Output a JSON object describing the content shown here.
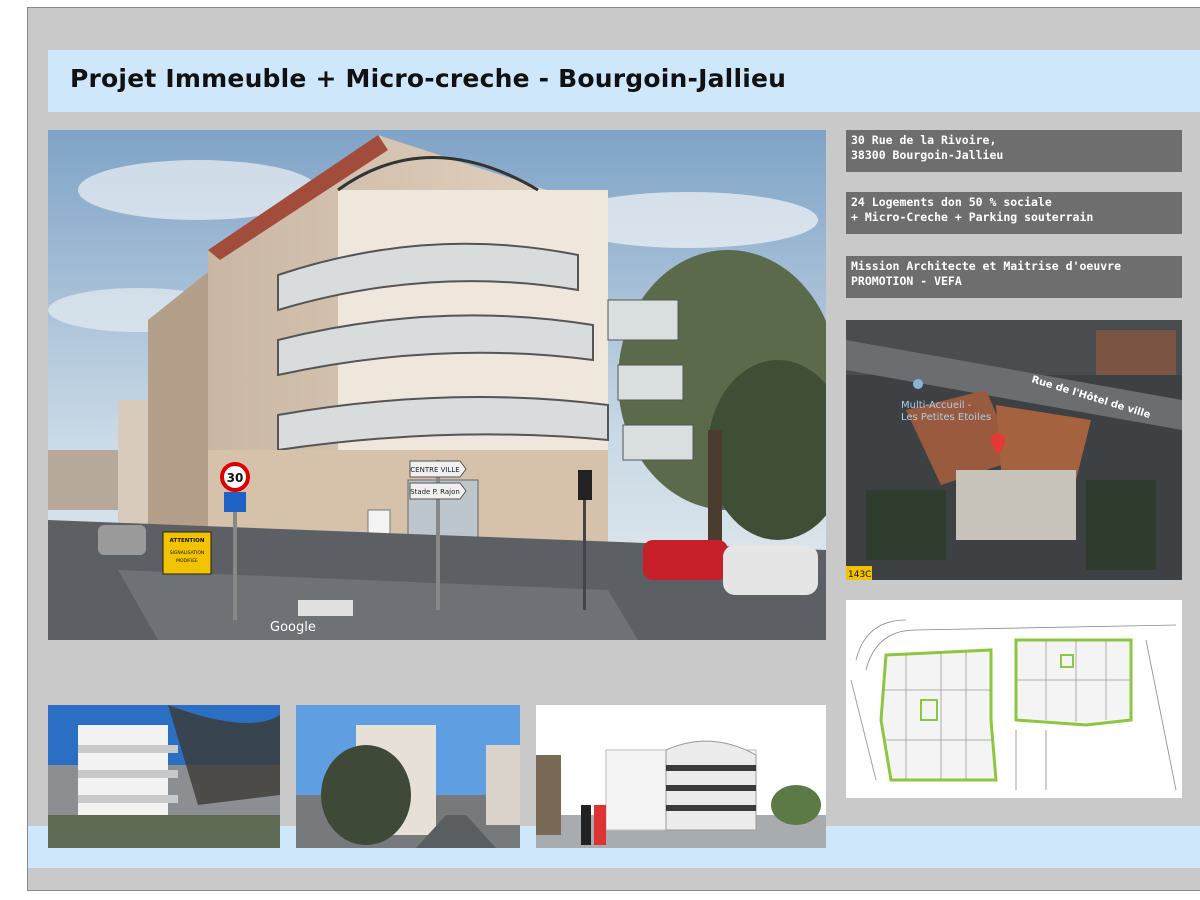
{
  "title": "Projet Immeuble + Micro-creche - Bourgoin-Jallieu",
  "info_boxes": [
    {
      "line1": "30 Rue de la Rivoire,",
      "line2": "38300 Bourgoin-Jallieu"
    },
    {
      "line1": "24 Logements don 50 % sociale",
      "line2": "+ Micro-Creche + Parking souterrain"
    },
    {
      "line1": "Mission Architecte et Maitrise d'oeuvre",
      "line2": "PROMOTION - VEFA"
    }
  ],
  "main_photo": {
    "watermark": "Google",
    "sign_centre": "CENTRE VILLE",
    "sign_stade": "Stade P. Rajon",
    "speed_limit": "30",
    "attention_title": "ATTENTION",
    "attention_line1": "SIGNALISATION",
    "attention_line2": "MODIFIEE"
  },
  "map": {
    "street_label": "Rue de l'Hôtel de ville",
    "place_line1": "Multi-Accueil -",
    "place_line2": "Les Petites Etoiles",
    "corner_tag": "143C"
  },
  "colors": {
    "title_band": "#cfe7fb",
    "slide_background": "#c9c9c9",
    "info_box": "#6e6e6e",
    "map_pin": "#e53935",
    "plan_outline": "#8dc63f"
  }
}
